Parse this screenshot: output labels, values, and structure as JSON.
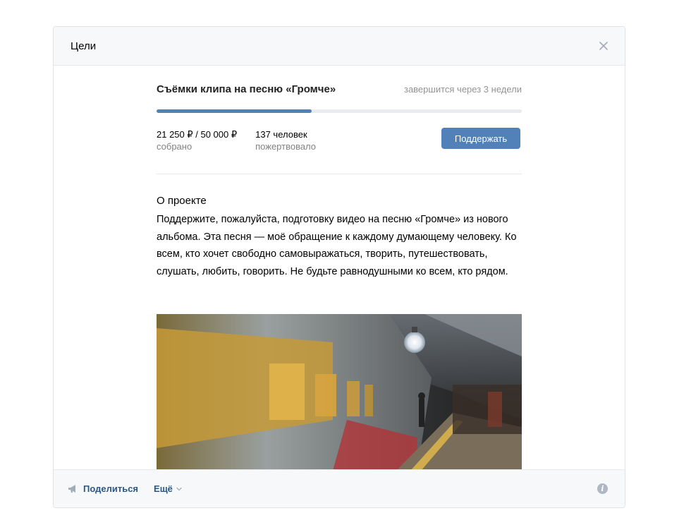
{
  "header": {
    "title": "Цели"
  },
  "goal": {
    "title": "Съёмки клипа на песню «Громче»",
    "deadline": "завершится через 3 недели",
    "progress": 0.425,
    "accent_color": "#5181b8"
  },
  "stats": {
    "collected_value": "21 250 ₽ / 50 000 ₽",
    "collected_label": "собрано",
    "donors_value": "137 человек",
    "donors_label": "пожертвовало"
  },
  "support_button": {
    "label": "Поддержать"
  },
  "about": {
    "title": "О проекте",
    "text": "Поддержите, пожалуйста, подготовку видео на песню «Громче» из нового альбома. Эта песня — моё обращение к каждому думающему человеку. Ко всем, кто хочет свободно самовыражаться, творить, путешествовать, слушать, любить, говорить. Не будьте равнодушными ко всем, кто рядом."
  },
  "footer": {
    "share_label": "Поделиться",
    "more_label": "Ещё"
  }
}
